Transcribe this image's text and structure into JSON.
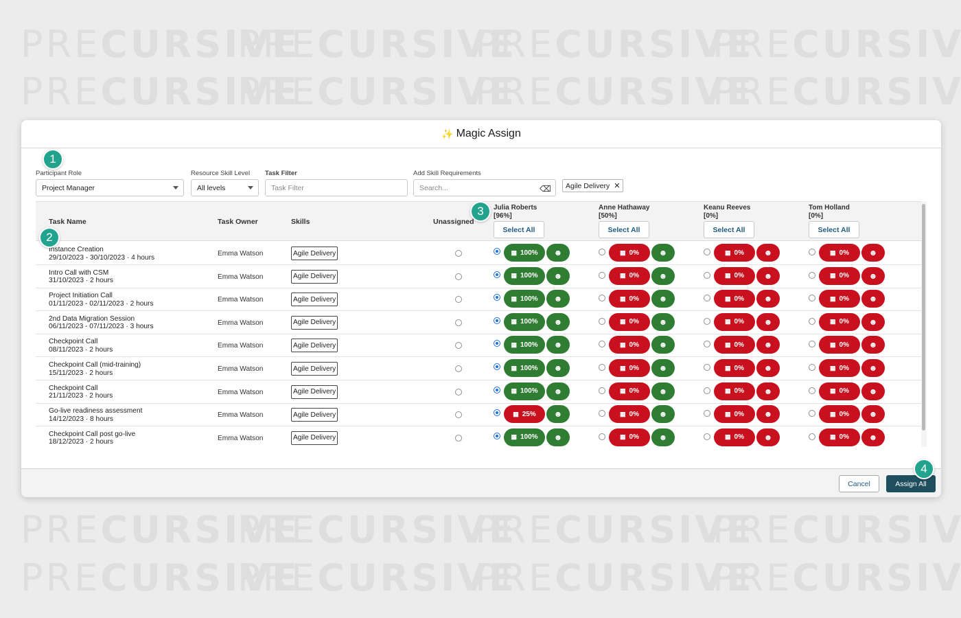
{
  "watermark": {
    "light": "PRE",
    "bold": "CURSIVE"
  },
  "modal": {
    "title": "Magic Assign",
    "sparkle": "✨"
  },
  "filters": {
    "participant_role": {
      "label": "Participant Role",
      "value": "Project Manager"
    },
    "skill_level": {
      "label": "Resource Skill Level",
      "value": "All levels"
    },
    "task_filter": {
      "label": "Task Filter",
      "placeholder": "Task Filter"
    },
    "skill_req": {
      "label": "Add Skill Requirements",
      "placeholder": "Search..."
    },
    "chip": "Agile Delivery"
  },
  "headers": {
    "task_name": "Task Name",
    "task_owner": "Task Owner",
    "skills": "Skills",
    "unassigned": "Unassigned"
  },
  "resources": [
    {
      "name": "Julia Roberts",
      "pct": "[96%]",
      "select_all": "Select All"
    },
    {
      "name": "Anne Hathaway",
      "pct": "[50%]",
      "select_all": "Select All"
    },
    {
      "name": "Keanu Reeves",
      "pct": "[0%]",
      "select_all": "Select All"
    },
    {
      "name": "Tom Holland",
      "pct": "[0%]",
      "select_all": "Select All"
    }
  ],
  "rows": [
    {
      "name": "Instance Creation",
      "meta": "29/10/2023 - 30/10/2023 · 4 hours",
      "owner": "Emma Watson",
      "skill": "Agile Delivery",
      "avail": [
        "100%",
        "0%",
        "0%",
        "0%"
      ],
      "skill_fit": [
        "green",
        "green",
        "red",
        "red"
      ],
      "selected": 0
    },
    {
      "name": "Intro Call with CSM",
      "meta": "31/10/2023 · 2 hours",
      "owner": "Emma Watson",
      "skill": "Agile Delivery",
      "avail": [
        "100%",
        "0%",
        "0%",
        "0%"
      ],
      "skill_fit": [
        "green",
        "green",
        "red",
        "red"
      ],
      "selected": 0
    },
    {
      "name": "Project Initiation Call",
      "meta": "01/11/2023 - 02/11/2023 · 2 hours",
      "owner": "Emma Watson",
      "skill": "Agile Delivery",
      "avail": [
        "100%",
        "0%",
        "0%",
        "0%"
      ],
      "skill_fit": [
        "green",
        "green",
        "red",
        "red"
      ],
      "selected": 0
    },
    {
      "name": "2nd Data Migration Session",
      "meta": "06/11/2023 - 07/11/2023 · 3 hours",
      "owner": "Emma Watson",
      "skill": "Agile Delivery",
      "avail": [
        "100%",
        "0%",
        "0%",
        "0%"
      ],
      "skill_fit": [
        "green",
        "green",
        "red",
        "red"
      ],
      "selected": 0
    },
    {
      "name": "Checkpoint Call",
      "meta": "08/11/2023 · 2 hours",
      "owner": "Emma Watson",
      "skill": "Agile Delivery",
      "avail": [
        "100%",
        "0%",
        "0%",
        "0%"
      ],
      "skill_fit": [
        "green",
        "green",
        "red",
        "red"
      ],
      "selected": 0
    },
    {
      "name": "Checkpoint Call (mid-training)",
      "meta": "15/11/2023 · 2 hours",
      "owner": "Emma Watson",
      "skill": "Agile Delivery",
      "avail": [
        "100%",
        "0%",
        "0%",
        "0%"
      ],
      "skill_fit": [
        "green",
        "green",
        "red",
        "red"
      ],
      "selected": 0
    },
    {
      "name": "Checkpoint Call",
      "meta": "21/11/2023 · 2 hours",
      "owner": "Emma Watson",
      "skill": "Agile Delivery",
      "avail": [
        "100%",
        "0%",
        "0%",
        "0%"
      ],
      "skill_fit": [
        "green",
        "green",
        "red",
        "red"
      ],
      "selected": 0
    },
    {
      "name": "Go-live readiness assessment",
      "meta": "14/12/2023 · 8 hours",
      "owner": "Emma Watson",
      "skill": "Agile Delivery",
      "avail": [
        "25%",
        "0%",
        "0%",
        "0%"
      ],
      "skill_fit": [
        "green",
        "green",
        "red",
        "red"
      ],
      "selected": 0
    },
    {
      "name": "Checkpoint Call post go-live",
      "meta": "18/12/2023 · 2 hours",
      "owner": "Emma Watson",
      "skill": "Agile Delivery",
      "avail": [
        "100%",
        "0%",
        "0%",
        "0%"
      ],
      "skill_fit": [
        "green",
        "green",
        "red",
        "red"
      ],
      "selected": 0
    }
  ],
  "footer": {
    "cancel": "Cancel",
    "assign_all": "Assign All"
  },
  "badges": [
    "1",
    "2",
    "3",
    "4"
  ],
  "colors": {
    "green": "#2e7d32",
    "red": "#c8101e",
    "primary": "#1f4e5f",
    "badge": "#22a38e"
  },
  "icons": {
    "calendar": "calendar-icon",
    "skill": "skill-head-icon",
    "clear": "clear-search-icon",
    "remove": "close-icon"
  }
}
